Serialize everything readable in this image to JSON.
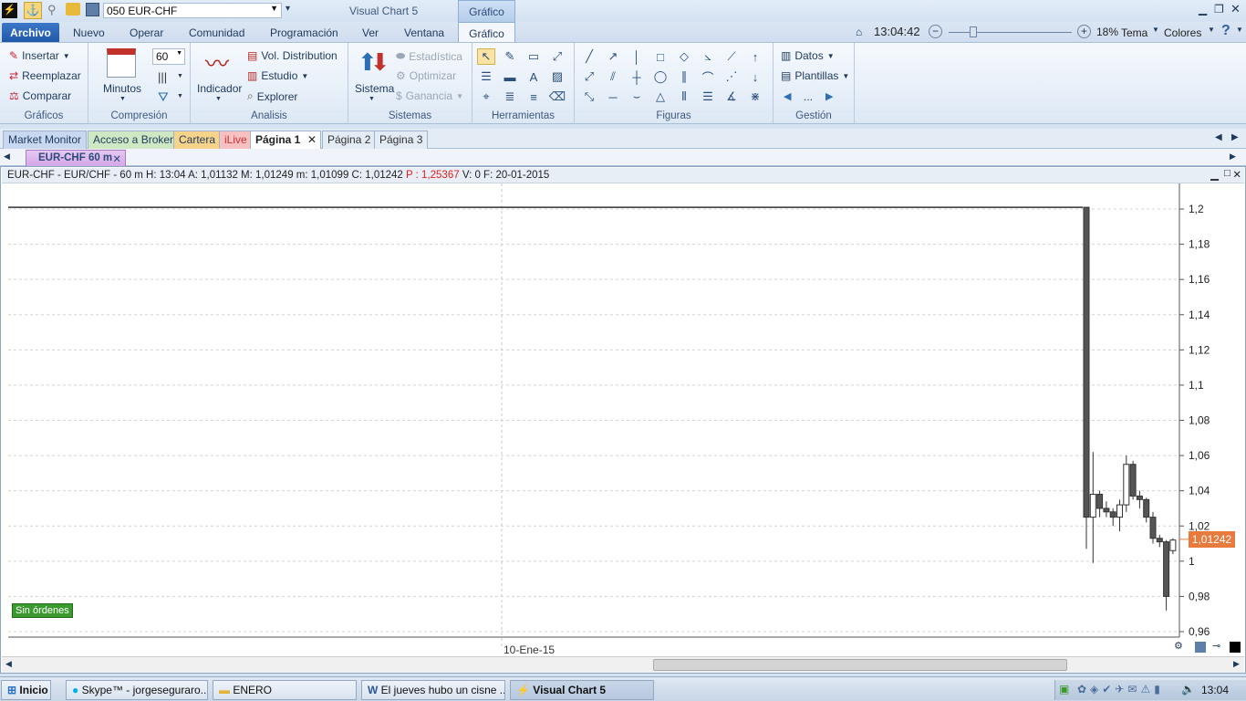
{
  "app": {
    "title": "Visual Chart 5",
    "context_tab": "Gráfico",
    "symbol_combo": "050 EUR-CHF",
    "clock": "13:04:42",
    "zoom": "18%",
    "theme_label": "Tema",
    "colors_label": "Colores",
    "help_label": "?"
  },
  "menu": {
    "archivo": "Archivo",
    "tabs": [
      "Nuevo",
      "Operar",
      "Comunidad",
      "Programación",
      "Ver",
      "Ventana",
      "Gráfico"
    ]
  },
  "ribbon": {
    "graficos": {
      "label": "Gráficos",
      "insertar": "Insertar",
      "reemplazar": "Reemplazar",
      "comparar": "Comparar"
    },
    "compresion": {
      "label": "Compresión",
      "minutos": "Minutos",
      "value": "60"
    },
    "analisis": {
      "label": "Analisis",
      "indicador": "Indicador",
      "vol": "Vol. Distribution",
      "estudio": "Estudio",
      "explorer": "Explorer"
    },
    "sistemas": {
      "label": "Sistemas",
      "sistema": "Sistema",
      "estadistica": "Estadística",
      "optimizar": "Optimizar",
      "ganancia": "Ganancia"
    },
    "herramientas": {
      "label": "Herramientas"
    },
    "figuras": {
      "label": "Figuras"
    },
    "gestion": {
      "label": "Gestión",
      "datos": "Datos",
      "plantillas": "Plantillas",
      "more": "..."
    }
  },
  "page_tabs": [
    "Market Monitor",
    "Acceso a Broker",
    "Cartera",
    "iLive",
    "Página 1",
    "Página 2",
    "Página 3"
  ],
  "doc_tab": "EUR-CHF 60 m",
  "chart": {
    "info_prefix": "EUR-CHF - EUR/CHF -  60 m  H: 13:04  A: 1,01132  M: 1,01249  m: 1,01099  C: 1,01242 ",
    "info_p": "P : 1,25367",
    "info_suffix": "  V: 0  F: 20-01-2015",
    "last_price": "1,01242",
    "date_label": "10-Ene-15",
    "orders_badge": "Sin órdenes",
    "y_ticks": [
      "1,2",
      "1,18",
      "1,16",
      "1,14",
      "1,12",
      "1,1",
      "1,08",
      "1,06",
      "1,04",
      "1,02",
      "1",
      "0,98",
      "0,96"
    ]
  },
  "chart_data": {
    "type": "candlestick",
    "symbol": "EUR-CHF",
    "ylim": [
      0.96,
      1.2
    ],
    "flat_level": 1.201,
    "candles": [
      {
        "o": 1.201,
        "h": 1.201,
        "l": 1.007,
        "c": 1.025
      },
      {
        "o": 1.025,
        "h": 1.062,
        "l": 0.999,
        "c": 1.038
      },
      {
        "o": 1.038,
        "h": 1.04,
        "l": 1.025,
        "c": 1.03
      },
      {
        "o": 1.03,
        "h": 1.034,
        "l": 1.025,
        "c": 1.028
      },
      {
        "o": 1.028,
        "h": 1.03,
        "l": 1.02,
        "c": 1.025
      },
      {
        "o": 1.025,
        "h": 1.035,
        "l": 1.017,
        "c": 1.032
      },
      {
        "o": 1.032,
        "h": 1.06,
        "l": 1.028,
        "c": 1.055
      },
      {
        "o": 1.055,
        "h": 1.057,
        "l": 1.035,
        "c": 1.037
      },
      {
        "o": 1.037,
        "h": 1.04,
        "l": 1.03,
        "c": 1.035
      },
      {
        "o": 1.035,
        "h": 1.036,
        "l": 1.022,
        "c": 1.025
      },
      {
        "o": 1.025,
        "h": 1.028,
        "l": 1.01,
        "c": 1.013
      },
      {
        "o": 1.013,
        "h": 1.015,
        "l": 1.008,
        "c": 1.011
      },
      {
        "o": 1.011,
        "h": 1.012,
        "l": 0.972,
        "c": 0.98
      },
      {
        "o": 1.006,
        "h": 1.013,
        "l": 1.004,
        "c": 1.012
      }
    ]
  },
  "taskbar": {
    "start": "Inicio",
    "items": [
      "Skype™ - jorgeseguraro...",
      "ENERO",
      "El jueves hubo un cisne ...",
      "Visual Chart 5"
    ],
    "time": "13:04"
  }
}
